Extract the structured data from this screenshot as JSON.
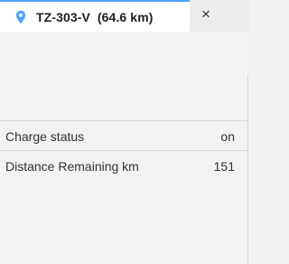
{
  "tab": {
    "title": "TZ-303-V  (64.6 km)",
    "close_label": "×",
    "pin_icon": "location-pin-icon",
    "accent_color": "#4da3ff"
  },
  "properties": [
    {
      "label": "Charge status",
      "value": "on"
    },
    {
      "label": "Distance Remaining km",
      "value": "151"
    }
  ]
}
